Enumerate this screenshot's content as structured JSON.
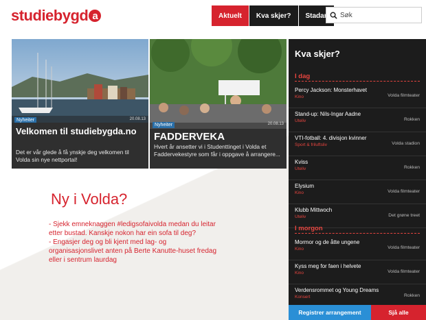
{
  "header": {
    "logo_text": "studiebygd",
    "logo_badge": "a",
    "nav": [
      {
        "label": "Aktuelt",
        "active": true
      },
      {
        "label": "Kva skjer?",
        "active": false
      },
      {
        "label": "Stadar",
        "active": false
      }
    ],
    "search": {
      "placeholder": "Søk",
      "value": ""
    }
  },
  "cards": [
    {
      "tag": "Nyheiter",
      "date": "20.08.13",
      "title": "Velkomen til studiebygda.no",
      "excerpt": "Det er vår glede å få ynskje deg velkomen til Volda sin nye nettportal!"
    },
    {
      "tag": "Nyheiter",
      "date": "20.08.13",
      "title": "FADDERVEKA",
      "excerpt": "Hvert år ansetter vi i Studenttinget i Volda et Faddervekestyre som får i oppgave å arrangere..."
    }
  ],
  "ny_i_volda": {
    "title": "Ny i Volda?",
    "items": [
      "- Sjekk emneknaggen #ledigsofaivolda medan du leitar etter bustad. Kanskje nokon har ein sofa til deg?",
      "- Engasjer deg og bli kjent med lag- og organisasjonslivet anten på Berte Kanutte-huset fredag eller i sentrum laurdag"
    ]
  },
  "sidebar": {
    "title": "Kva skjer?",
    "days": [
      {
        "label": "I dag",
        "events": [
          {
            "title": "Percy Jackson: Monsterhavet",
            "category": "Kino",
            "venue": "Volda filmteater"
          },
          {
            "title": "Stand-up: Nils-Ingar Aadne",
            "category": "Uteliv",
            "venue": "Rokken"
          },
          {
            "title": "VTI-fotball: 4. divisjon kvinner",
            "category": "Sport & friluftsliv",
            "venue": "Volda stadion"
          },
          {
            "title": "Kviss",
            "category": "Uteliv",
            "venue": "Rokken"
          },
          {
            "title": "Elysium",
            "category": "Kino",
            "venue": "Volda filmteater"
          },
          {
            "title": "Klubb Mittwoch",
            "category": "Uteliv",
            "venue": "Det grøne treet"
          }
        ]
      },
      {
        "label": "I morgon",
        "events": [
          {
            "title": "Mormor og de åtte ungene",
            "category": "Kino",
            "venue": "Volda filmteater"
          },
          {
            "title": "Kyss meg for faen i helvete",
            "category": "Kino",
            "venue": "Volda filmteater"
          },
          {
            "title": "Verdensrommet og Young Dreams",
            "category": "Konsert",
            "venue": "Rokken"
          }
        ]
      }
    ],
    "register_label": "Registrer arrangement",
    "see_all_label": "Sjå alle"
  },
  "colors": {
    "brand_red": "#d6232e",
    "dark": "#1c1c1c",
    "blue": "#2a8fd6"
  }
}
